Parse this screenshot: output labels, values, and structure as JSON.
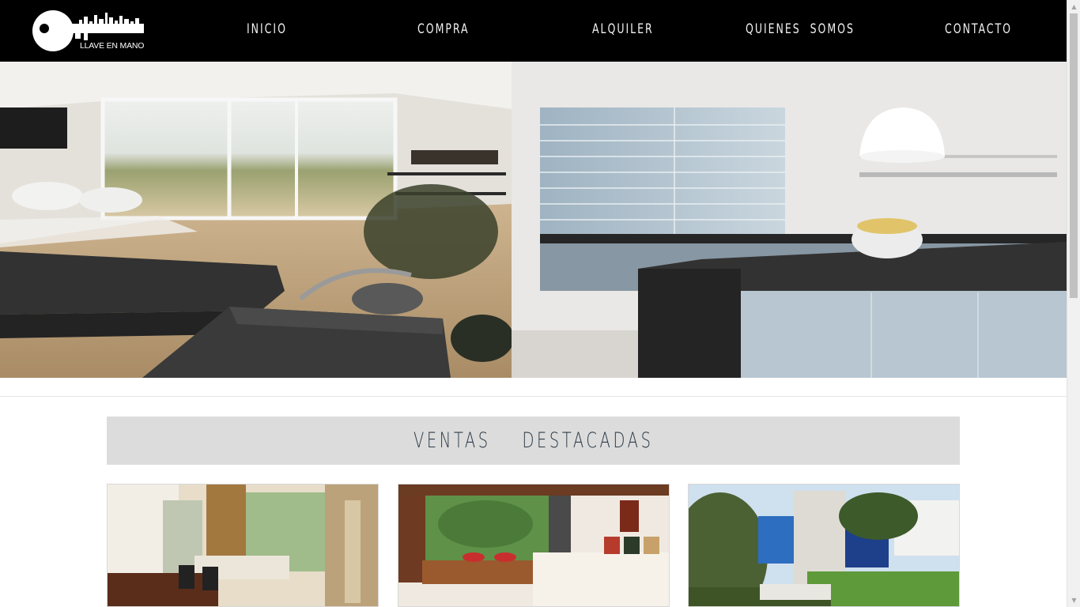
{
  "brand": {
    "logo_text": "LLAVE EN MANO",
    "logo_icon": "key-skyline-icon"
  },
  "nav": {
    "items": [
      "INICIO",
      "COMPRA",
      "ALQUILER",
      "QUIENES  SOMOS",
      "CONTACTO"
    ]
  },
  "hero": {
    "images": [
      "living-room-photo",
      "kitchen-photo"
    ]
  },
  "featured": {
    "title": "VENTAS  DESTACADAS",
    "cards": [
      "dining-living-photo",
      "bedroom-photo",
      "garden-house-photo"
    ]
  },
  "colors": {
    "header_bg": "#000000",
    "nav_text": "#f2f2f2",
    "band_bg": "#dcdcdc",
    "title_text": "#2d3a47"
  }
}
